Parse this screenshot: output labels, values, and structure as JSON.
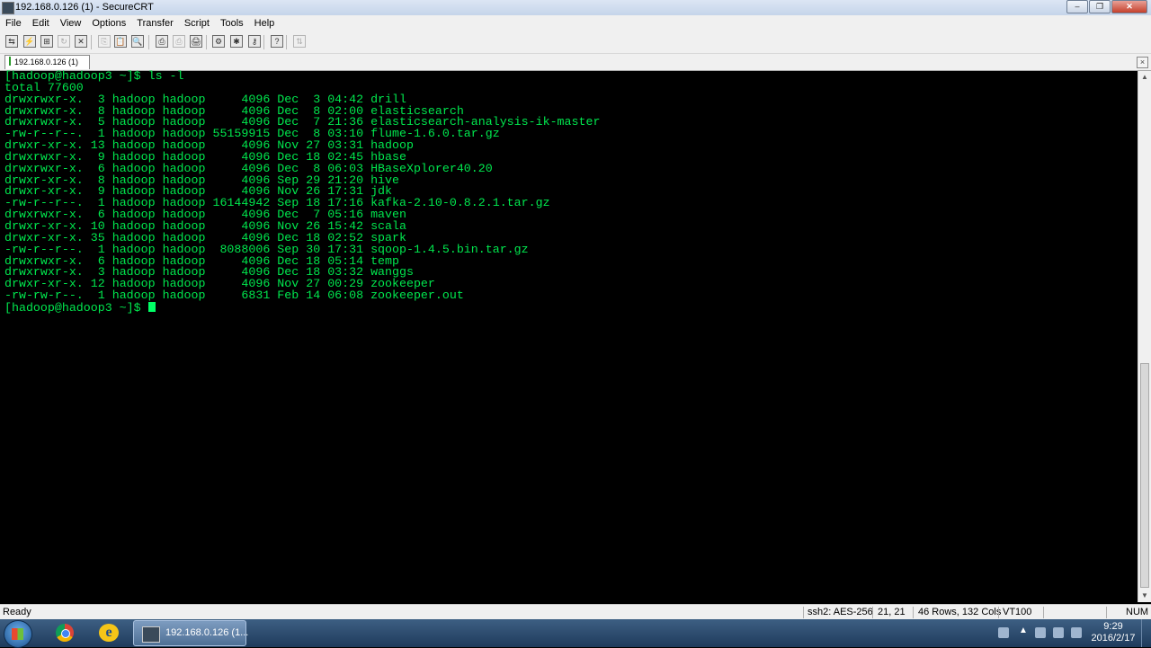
{
  "window": {
    "title": "192.168.0.126 (1) - SecureCRT"
  },
  "menu": [
    "File",
    "Edit",
    "View",
    "Options",
    "Transfer",
    "Script",
    "Tools",
    "Help"
  ],
  "toolbar": {
    "icons": [
      "connect-icon",
      "quick-connect-icon",
      "connect-in-tab-icon",
      "reconnect-icon",
      "disconnect-icon",
      "copy-icon",
      "paste-icon",
      "find-icon",
      "print-icon",
      "print-selection-icon",
      "print-screen-icon",
      "session-options-icon",
      "global-options-icon",
      "keymap-icon",
      "help-icon",
      "sftp-icon"
    ]
  },
  "tab": {
    "label": "192.168.0.126  (1)",
    "close": "×"
  },
  "terminal": {
    "prompt_cmd": "[hadoop@hadoop3 ~]$ ls -l",
    "total": "total 77600",
    "rows": [
      {
        "perm": "drwxrwxr-x.",
        "links": " 3",
        "owner": "hadoop",
        "group": "hadoop",
        "size": "    4096",
        "month": "Dec",
        "day": " 3",
        "time": "04:42",
        "name": "drill"
      },
      {
        "perm": "drwxrwxr-x.",
        "links": " 8",
        "owner": "hadoop",
        "group": "hadoop",
        "size": "    4096",
        "month": "Dec",
        "day": " 8",
        "time": "02:00",
        "name": "elasticsearch"
      },
      {
        "perm": "drwxrwxr-x.",
        "links": " 5",
        "owner": "hadoop",
        "group": "hadoop",
        "size": "    4096",
        "month": "Dec",
        "day": " 7",
        "time": "21:36",
        "name": "elasticsearch-analysis-ik-master"
      },
      {
        "perm": "-rw-r--r--.",
        "links": " 1",
        "owner": "hadoop",
        "group": "hadoop",
        "size": "55159915",
        "month": "Dec",
        "day": " 8",
        "time": "03:10",
        "name": "flume-1.6.0.tar.gz"
      },
      {
        "perm": "drwxr-xr-x.",
        "links": "13",
        "owner": "hadoop",
        "group": "hadoop",
        "size": "    4096",
        "month": "Nov",
        "day": "27",
        "time": "03:31",
        "name": "hadoop"
      },
      {
        "perm": "drwxrwxr-x.",
        "links": " 9",
        "owner": "hadoop",
        "group": "hadoop",
        "size": "    4096",
        "month": "Dec",
        "day": "18",
        "time": "02:45",
        "name": "hbase"
      },
      {
        "perm": "drwxrwxr-x.",
        "links": " 6",
        "owner": "hadoop",
        "group": "hadoop",
        "size": "    4096",
        "month": "Dec",
        "day": " 8",
        "time": "06:03",
        "name": "HBaseXplorer40.20"
      },
      {
        "perm": "drwxr-xr-x.",
        "links": " 8",
        "owner": "hadoop",
        "group": "hadoop",
        "size": "    4096",
        "month": "Sep",
        "day": "29",
        "time": "21:20",
        "name": "hive"
      },
      {
        "perm": "drwxr-xr-x.",
        "links": " 9",
        "owner": "hadoop",
        "group": "hadoop",
        "size": "    4096",
        "month": "Nov",
        "day": "26",
        "time": "17:31",
        "name": "jdk"
      },
      {
        "perm": "-rw-r--r--.",
        "links": " 1",
        "owner": "hadoop",
        "group": "hadoop",
        "size": "16144942",
        "month": "Sep",
        "day": "18",
        "time": "17:16",
        "name": "kafka-2.10-0.8.2.1.tar.gz"
      },
      {
        "perm": "drwxrwxr-x.",
        "links": " 6",
        "owner": "hadoop",
        "group": "hadoop",
        "size": "    4096",
        "month": "Dec",
        "day": " 7",
        "time": "05:16",
        "name": "maven"
      },
      {
        "perm": "drwxr-xr-x.",
        "links": "10",
        "owner": "hadoop",
        "group": "hadoop",
        "size": "    4096",
        "month": "Nov",
        "day": "26",
        "time": "15:42",
        "name": "scala"
      },
      {
        "perm": "drwxr-xr-x.",
        "links": "35",
        "owner": "hadoop",
        "group": "hadoop",
        "size": "    4096",
        "month": "Dec",
        "day": "18",
        "time": "02:52",
        "name": "spark"
      },
      {
        "perm": "-rw-r--r--.",
        "links": " 1",
        "owner": "hadoop",
        "group": "hadoop",
        "size": " 8088006",
        "month": "Sep",
        "day": "30",
        "time": "17:31",
        "name": "sqoop-1.4.5.bin.tar.gz"
      },
      {
        "perm": "drwxrwxr-x.",
        "links": " 6",
        "owner": "hadoop",
        "group": "hadoop",
        "size": "    4096",
        "month": "Dec",
        "day": "18",
        "time": "05:14",
        "name": "temp"
      },
      {
        "perm": "drwxrwxr-x.",
        "links": " 3",
        "owner": "hadoop",
        "group": "hadoop",
        "size": "    4096",
        "month": "Dec",
        "day": "18",
        "time": "03:32",
        "name": "wanggs"
      },
      {
        "perm": "drwxr-xr-x.",
        "links": "12",
        "owner": "hadoop",
        "group": "hadoop",
        "size": "    4096",
        "month": "Nov",
        "day": "27",
        "time": "00:29",
        "name": "zookeeper"
      },
      {
        "perm": "-rw-rw-r--.",
        "links": " 1",
        "owner": "hadoop",
        "group": "hadoop",
        "size": "    6831",
        "month": "Feb",
        "day": "14",
        "time": "06:08",
        "name": "zookeeper.out"
      }
    ],
    "prompt": "[hadoop@hadoop3 ~]$ ",
    "colors": {
      "text": "#00e84e",
      "background": "#000000"
    }
  },
  "status": {
    "ready": "Ready",
    "cipher": "ssh2: AES-256",
    "position": "21,  21",
    "size": "46 Rows, 132 Cols",
    "emulation": "VT100",
    "num": "NUM"
  },
  "taskbar": {
    "task_label": "192.168.0.126 (1...",
    "time": "9:29",
    "date": "2016/2/17"
  }
}
